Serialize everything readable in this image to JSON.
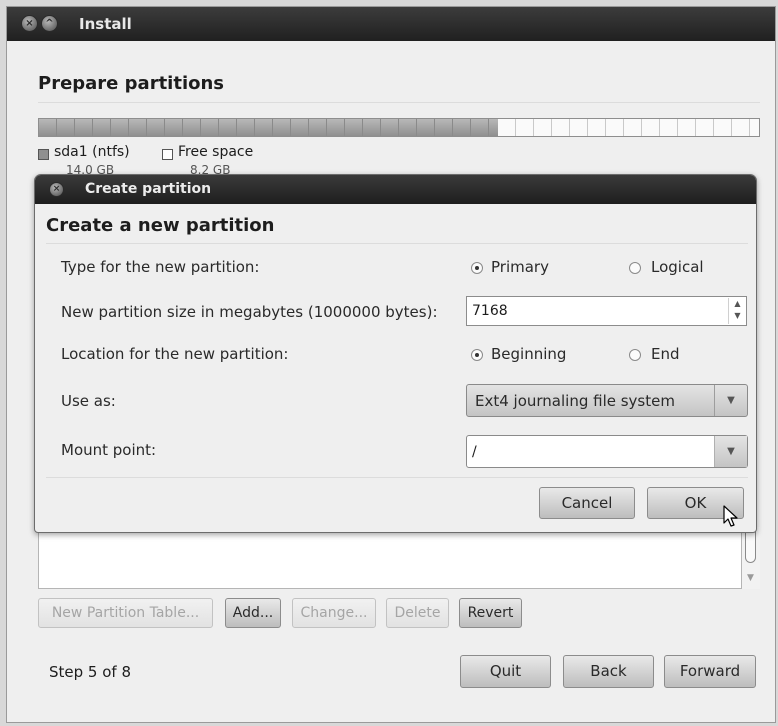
{
  "window": {
    "title": "Install",
    "close_glyph": "×",
    "min_glyph": "^"
  },
  "prepare": {
    "title": "Prepare partitions",
    "partition_bar": {
      "used_fraction": 0.638
    },
    "legend": [
      {
        "name": "sda1 (ntfs)",
        "size": "14.0 GB",
        "swatch": "#8f8f8f"
      },
      {
        "name": "Free space",
        "size": "8.2 GB",
        "swatch": "#ffffff"
      }
    ]
  },
  "dialog": {
    "title": "Create partition",
    "heading": "Create a new partition",
    "type_label": "Type for the new partition:",
    "type_options": {
      "primary": "Primary",
      "logical": "Logical",
      "selected": "Primary"
    },
    "size_label": "New partition size in megabytes (1000000 bytes):",
    "size_value": "7168",
    "location_label": "Location for the new partition:",
    "location_options": {
      "beginning": "Beginning",
      "end": "End",
      "selected": "Beginning"
    },
    "useas_label": "Use as:",
    "useas_value": "Ext4 journaling file system",
    "mount_label": "Mount point:",
    "mount_value": "/",
    "cancel": "Cancel",
    "ok": "OK"
  },
  "toolbar": {
    "new_table": "New Partition Table...",
    "add": "Add...",
    "change": "Change...",
    "delete": "Delete",
    "revert": "Revert"
  },
  "footer": {
    "step": "Step 5 of 8",
    "quit": "Quit",
    "back": "Back",
    "forward": "Forward"
  },
  "icons": {
    "spin_up": "▲",
    "spin_down": "▼",
    "dropdown": "▼"
  }
}
